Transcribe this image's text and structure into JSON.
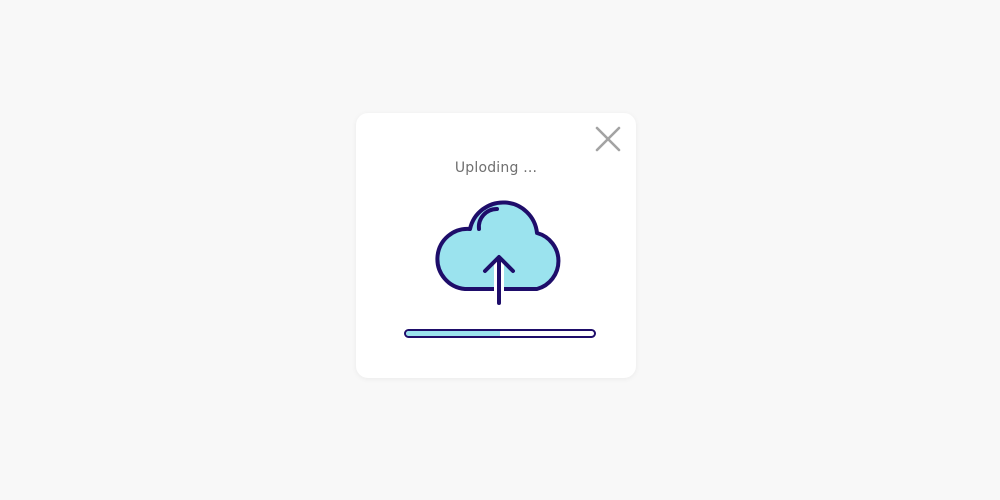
{
  "dialog": {
    "status_text": "Uploding ...",
    "progress": 0.5
  },
  "icons": {
    "close": "close-icon",
    "upload": "cloud-upload-icon"
  },
  "colors": {
    "background": "#f8f8f8",
    "card": "#ffffff",
    "cloud_fill": "#9be3ee",
    "outline": "#1e0d6a",
    "progress_fill": "#9be3ee",
    "close_icon": "#a3a3a3",
    "text": "#6f6f6f"
  }
}
